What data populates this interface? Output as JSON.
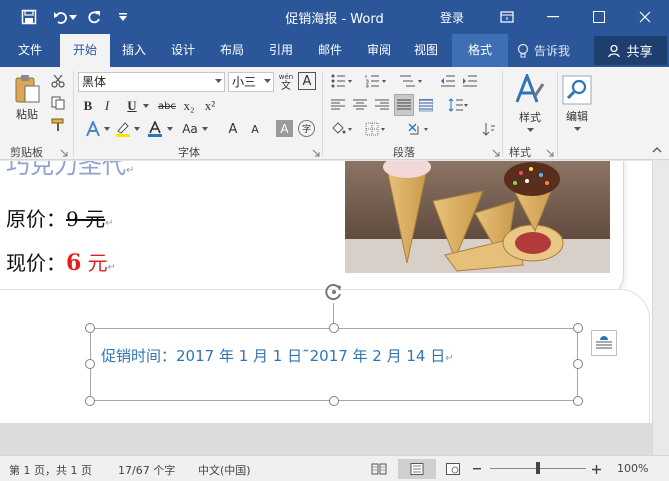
{
  "window": {
    "doc_title": "促销海报",
    "app_name": "Word",
    "title_separator": "-",
    "login_label": "登录"
  },
  "tabs": [
    "文件",
    "开始",
    "插入",
    "设计",
    "布局",
    "引用",
    "邮件",
    "审阅",
    "视图"
  ],
  "active_tab": "开始",
  "context_tab": "格式",
  "tell_me": "告诉我",
  "share": "共享",
  "ribbon": {
    "clipboard": {
      "paste": "粘贴",
      "group": "剪贴板"
    },
    "font": {
      "font_name": "黑体",
      "font_size": "小三",
      "pinyin_top": "wén",
      "pinyin_bottom": "文",
      "border_char": "A",
      "bold": "B",
      "italic": "I",
      "underline": "U",
      "strike": "abc",
      "sub": "x₂",
      "sup": "x²",
      "case": "Aa",
      "grow": "A",
      "shrink": "A",
      "shade_char": "A",
      "enclose_char": "字",
      "group": "字体"
    },
    "paragraph": {
      "group": "段落"
    },
    "styles": {
      "label": "样式",
      "group": "样式"
    },
    "editing": {
      "label": "编辑"
    }
  },
  "document": {
    "heading_text": "巧克力圣代",
    "original_price_label": "原价：",
    "original_price_value": "9 元",
    "current_price_label": "现价：",
    "current_price_value": "6",
    "current_price_unit": "元",
    "paragraph_mark": "↵",
    "promo_text": "促销时间：2017 年 1 月 1 日˜2017 年 2 月 14 日"
  },
  "statusbar": {
    "page": "第 1 页，共 1 页",
    "words": "17/67 个字",
    "language": "中文(中国)",
    "zoom": "100%"
  },
  "colors": {
    "brand_blue": "#2b579a",
    "price_red": "#e02020",
    "textbox_blue": "#2e75b6"
  }
}
